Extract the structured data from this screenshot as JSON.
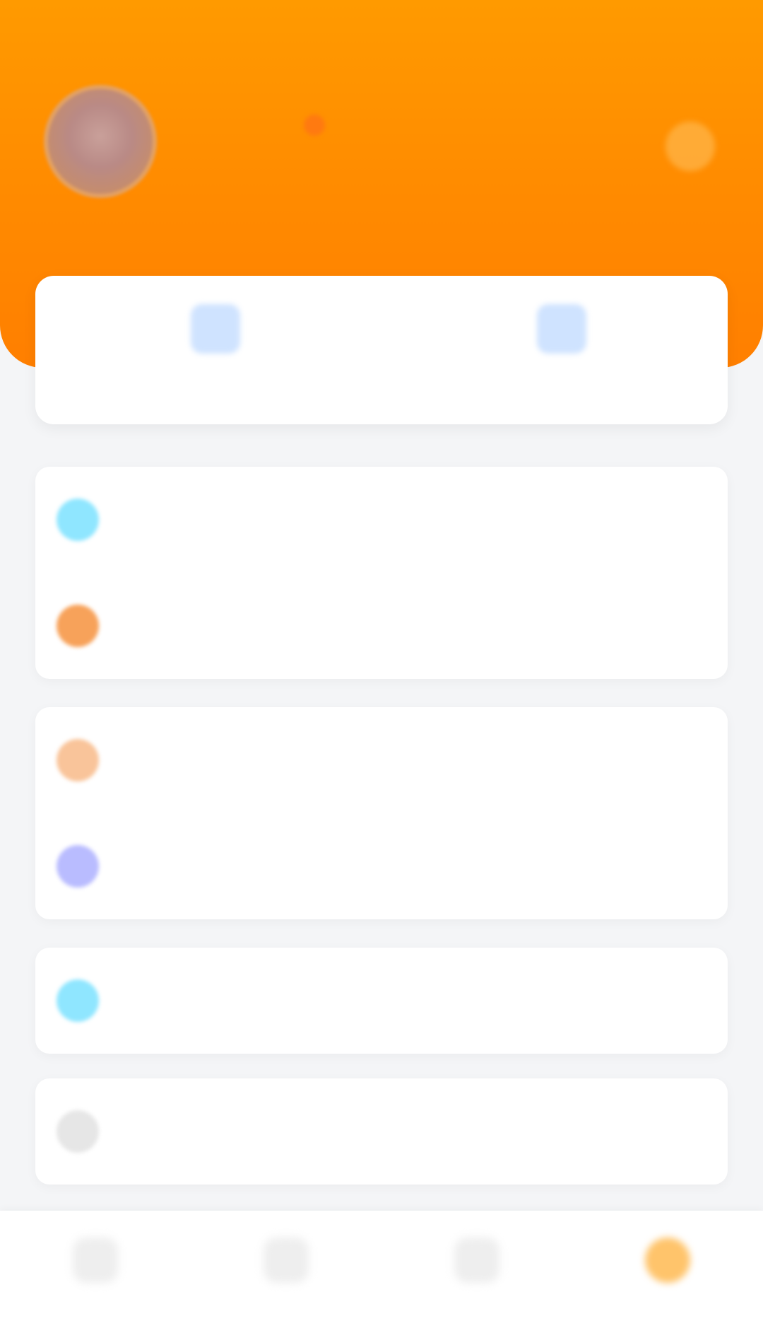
{
  "header": {
    "user_name": "",
    "user_subtitle": "",
    "colors": {
      "gradient_top": "#ff9a00",
      "gradient_bottom": "#ff7f00"
    }
  },
  "quick_actions": [
    {
      "label": "",
      "icon": "document-icon"
    },
    {
      "label": "",
      "icon": "person-icon"
    }
  ],
  "menu_groups": [
    {
      "rows": [
        {
          "label": "",
          "icon": "calendar-icon",
          "icon_color": "#8fe6ff",
          "value": ""
        },
        {
          "label": "",
          "icon": "gift-icon",
          "icon_color": "#f7a25a",
          "value": ""
        }
      ]
    },
    {
      "rows": [
        {
          "label": "",
          "icon": "wallet-icon",
          "icon_color": "#f9c49a",
          "value": ""
        },
        {
          "label": "",
          "icon": "star-icon",
          "icon_color": "#b9bcff",
          "value": ""
        }
      ]
    },
    {
      "rows": [
        {
          "label": "",
          "icon": "info-icon",
          "icon_color": "#8fe6ff",
          "value": ""
        }
      ]
    },
    {
      "rows": [
        {
          "label": "",
          "icon": "logout-icon",
          "icon_color": "#e6e6e6",
          "value": ""
        }
      ]
    }
  ],
  "bottom_nav": [
    {
      "label": "",
      "icon": "home-icon",
      "active": false
    },
    {
      "label": "",
      "icon": "list-icon",
      "active": false
    },
    {
      "label": "",
      "icon": "message-icon",
      "active": false
    },
    {
      "label": "",
      "icon": "profile-icon",
      "active": true
    }
  ]
}
